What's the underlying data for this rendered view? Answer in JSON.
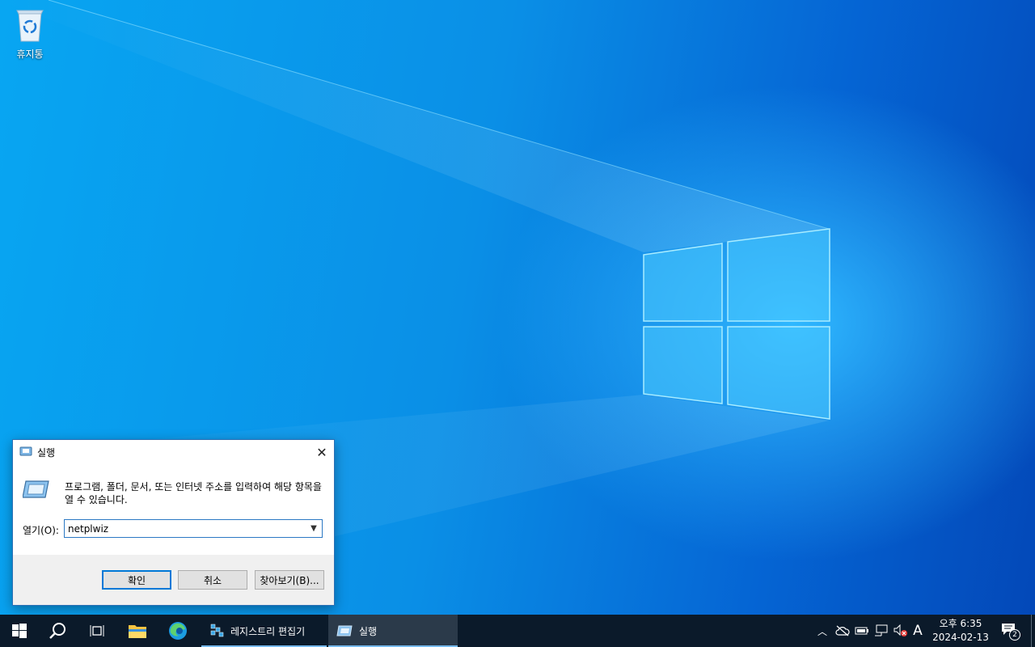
{
  "desktop": {
    "icons": [
      {
        "label": "휴지통",
        "icon": "recycle-bin-icon"
      }
    ]
  },
  "run_dialog": {
    "title": "실행",
    "description": "프로그램, 폴더, 문서, 또는 인터넷 주소를 입력하여 해당 항목을 열 수 있습니다.",
    "open_label": "열기(O):",
    "open_value": "netplwiz",
    "buttons": {
      "ok": "확인",
      "cancel": "취소",
      "browse": "찾아보기(B)..."
    }
  },
  "taskbar": {
    "apps": [
      {
        "label": "레지스트리 편집기",
        "icon": "regedit-icon"
      },
      {
        "label": "실행",
        "icon": "run-icon"
      }
    ],
    "tray": {
      "ime": "A",
      "time": "오후 6:35",
      "date": "2024-02-13",
      "notification_count": "2"
    }
  },
  "colors": {
    "accent": "#0078d7",
    "taskbar": "#0b1a2a"
  }
}
